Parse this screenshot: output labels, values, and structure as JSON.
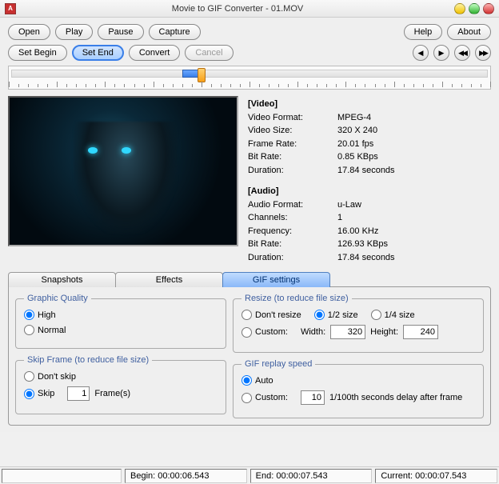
{
  "window": {
    "title": "Movie to GIF Converter - 01.MOV"
  },
  "toolbar": {
    "open": "Open",
    "play": "Play",
    "pause": "Pause",
    "capture": "Capture",
    "help": "Help",
    "about": "About",
    "setBegin": "Set Begin",
    "setEnd": "Set End",
    "convert": "Convert",
    "cancel": "Cancel"
  },
  "timeline": {
    "sel_left_pct": 36,
    "sel_width_pct": 4,
    "marker_pct": 40
  },
  "video": {
    "header": "[Video]",
    "formatLabel": "Video Format:",
    "format": "MPEG-4",
    "sizeLabel": "Video Size:",
    "size": "320 X 240",
    "rateLabel": "Frame Rate:",
    "rate": "20.01 fps",
    "bitrateLabel": "Bit Rate:",
    "bitrate": "0.85 KBps",
    "durationLabel": "Duration:",
    "duration": "17.84 seconds"
  },
  "audio": {
    "header": "[Audio]",
    "formatLabel": "Audio Format:",
    "format": "u-Law",
    "channelsLabel": "Channels:",
    "channels": "1",
    "freqLabel": "Frequency:",
    "freq": "16.00 KHz",
    "bitrateLabel": "Bit Rate:",
    "bitrate": "126.93 KBps",
    "durationLabel": "Duration:",
    "duration": "17.84 seconds"
  },
  "tabs": {
    "snapshots": "Snapshots",
    "effects": "Effects",
    "gif": "GIF settings"
  },
  "quality": {
    "legend": "Graphic Quality",
    "high": "High",
    "normal": "Normal"
  },
  "skip": {
    "legend": "Skip Frame (to reduce file size)",
    "dont": "Don't skip",
    "skip": "Skip",
    "value": "1",
    "frames": "Frame(s)"
  },
  "resize": {
    "legend": "Resize (to reduce file size)",
    "dont": "Don't resize",
    "half": "1/2 size",
    "quarter": "1/4 size",
    "custom": "Custom:",
    "widthLabel": "Width:",
    "width": "320",
    "heightLabel": "Height:",
    "height": "240"
  },
  "replay": {
    "legend": "GIF replay speed",
    "auto": "Auto",
    "custom": "Custom:",
    "value": "10",
    "suffix": "1/100th seconds delay after frame"
  },
  "status": {
    "beginLabel": "Begin:",
    "begin": "00:00:06.543",
    "endLabel": "End:",
    "end": "00:00:07.543",
    "currentLabel": "Current:",
    "current": "00:00:07.543"
  }
}
